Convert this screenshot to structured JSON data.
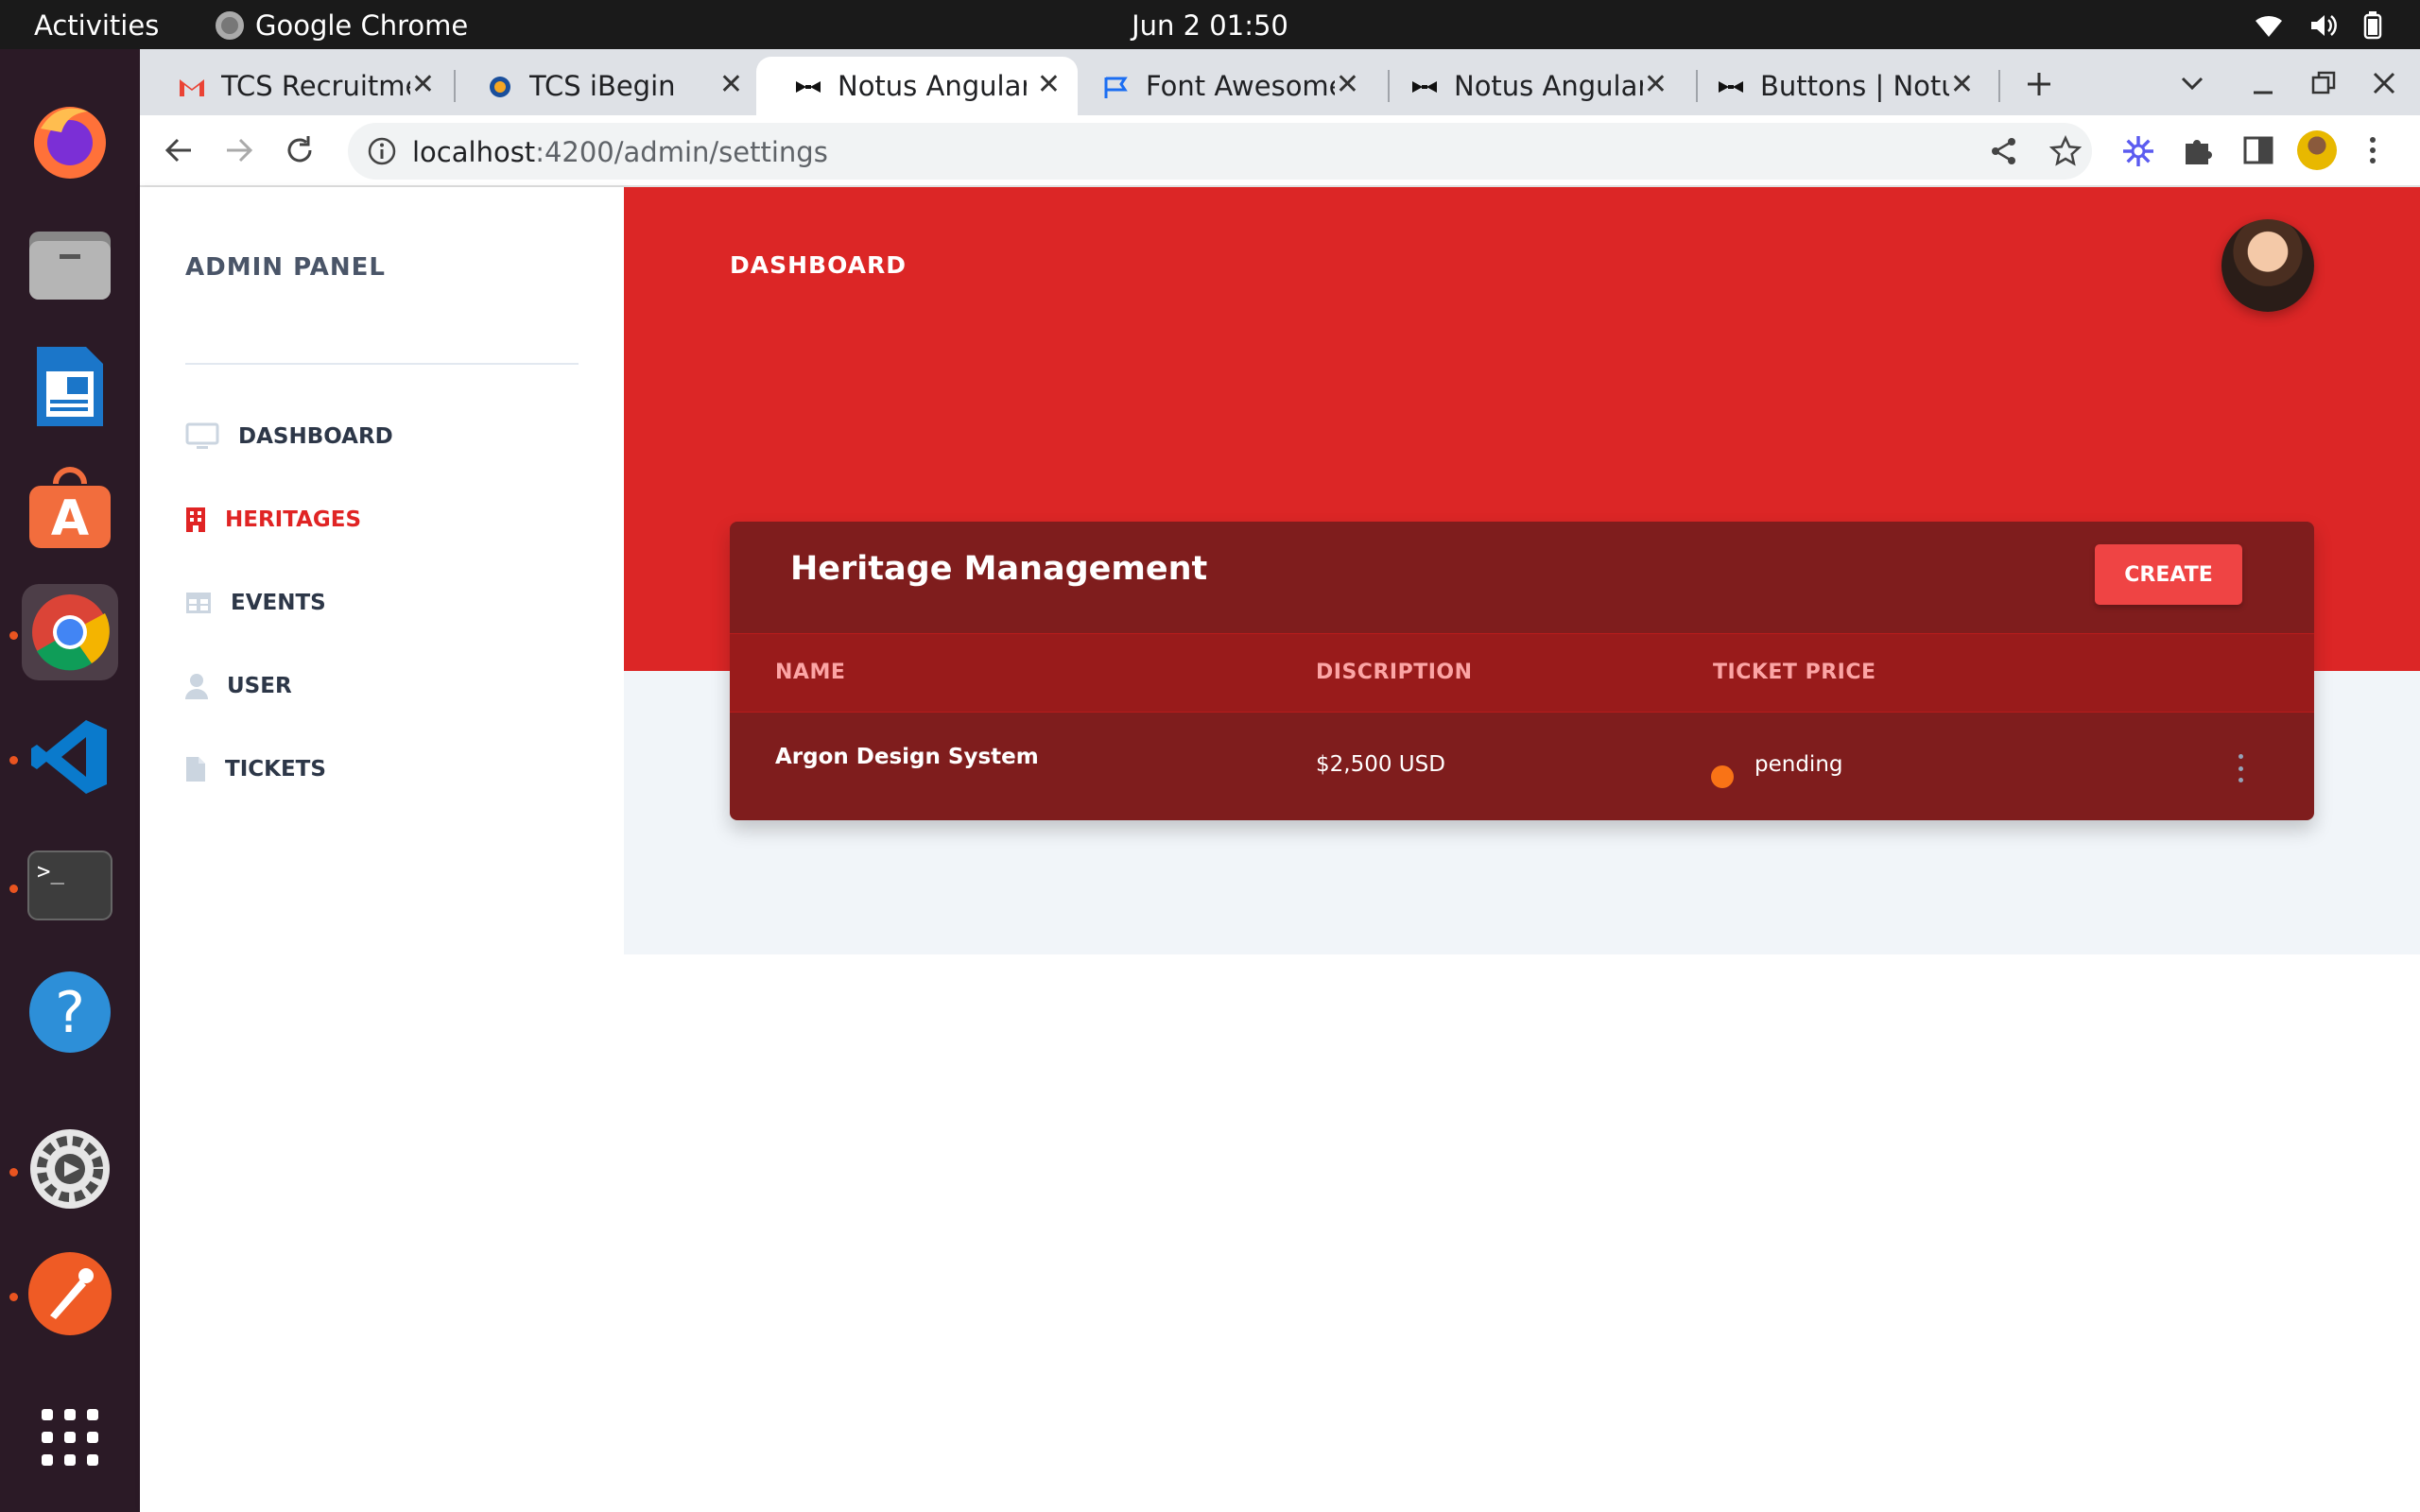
{
  "os": {
    "activities": "Activities",
    "app_name": "Google Chrome",
    "clock": "Jun 2  01:50"
  },
  "tabs": [
    {
      "title": "TCS Recruitme",
      "icon": "gmail-icon"
    },
    {
      "title": "TCS iBegin",
      "icon": "tcs-icon"
    },
    {
      "title": "Notus Angular",
      "icon": "notus-icon"
    },
    {
      "title": "Font Awesome",
      "icon": "flag-icon"
    },
    {
      "title": "Notus Angular",
      "icon": "notus-icon"
    },
    {
      "title": "Buttons | Notu",
      "icon": "notus-icon"
    }
  ],
  "address": {
    "host": "localhost",
    "path": ":4200/admin/settings"
  },
  "sidebar": {
    "brand": "ADMIN PANEL",
    "items": [
      {
        "label": "DASHBOARD",
        "icon": "tv-icon"
      },
      {
        "label": "HERITAGES",
        "icon": "building-icon"
      },
      {
        "label": "EVENTS",
        "icon": "table-icon"
      },
      {
        "label": "USER",
        "icon": "user-icon"
      },
      {
        "label": "TICKETS",
        "icon": "file-icon"
      }
    ]
  },
  "header": {
    "title": "DASHBOARD"
  },
  "card": {
    "title": "Heritage Management",
    "create_label": "CREATE",
    "columns": [
      "NAME",
      "DISCRIPTION",
      "TICKET PRICE"
    ],
    "rows": [
      {
        "name": "Argon Design System",
        "description": "$2,500 USD",
        "status": "pending"
      }
    ]
  },
  "colors": {
    "hero": "#dc2626",
    "card": "#7f1d1d",
    "active_nav": "#e02424",
    "status_pending": "#f97316"
  }
}
